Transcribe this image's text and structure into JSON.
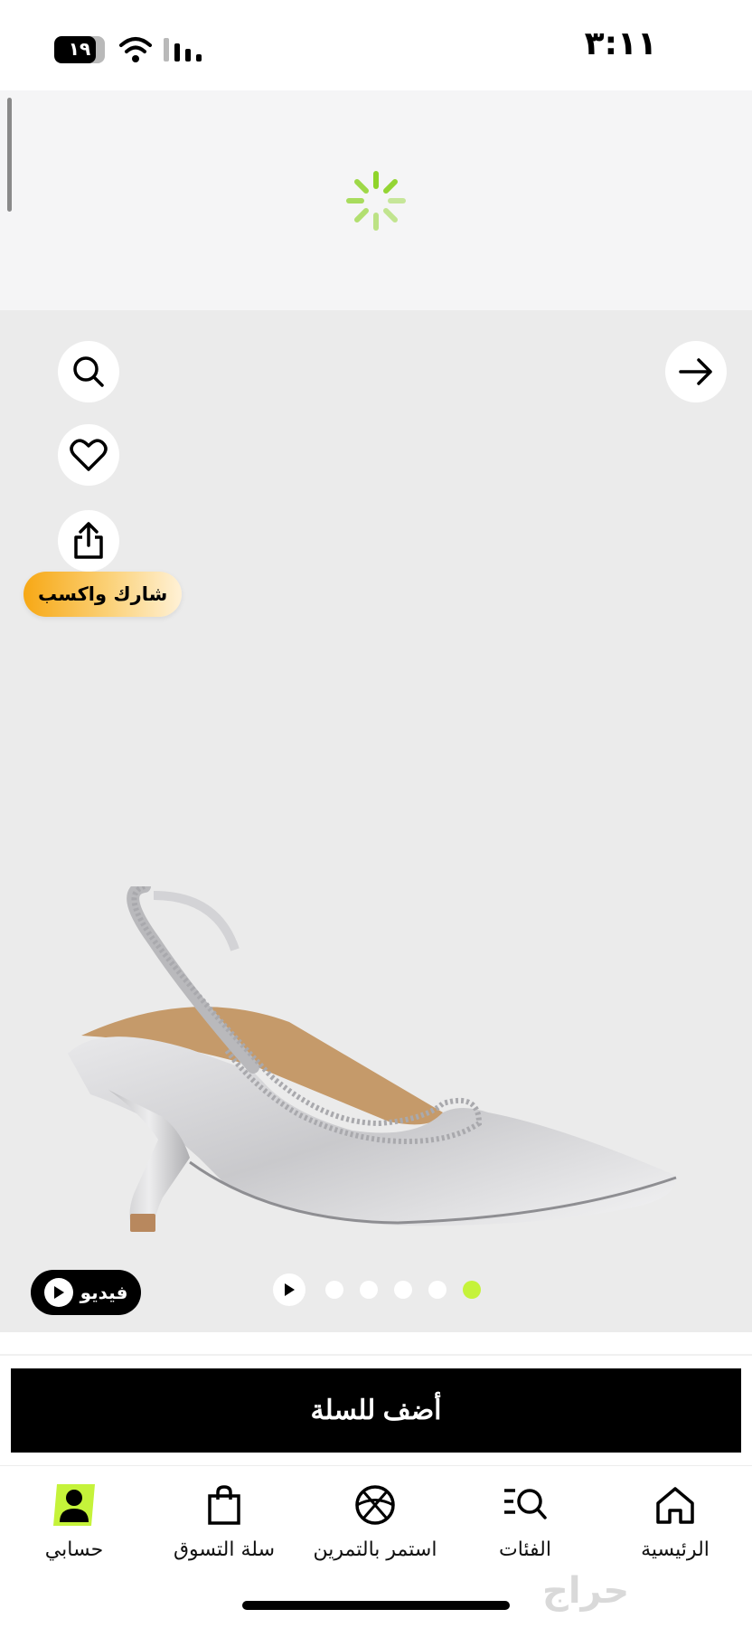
{
  "status_bar": {
    "time": "٣:١١",
    "battery": "١٩"
  },
  "gallery": {
    "share_earn_label": "شارك واكسب",
    "video_label": "فيديو",
    "dots_count": 5,
    "active_dot_index": 4
  },
  "actions": {
    "add_to_cart": "أضف للسلة"
  },
  "bottom_nav": {
    "items": [
      {
        "label": "حسابي",
        "icon": "user-icon"
      },
      {
        "label": "سلة التسوق",
        "icon": "shopping-bag-icon"
      },
      {
        "label": "استمر بالتمرين",
        "icon": "basketball-icon"
      },
      {
        "label": "الفئات",
        "icon": "categories-search-icon"
      },
      {
        "label": "الرئيسية",
        "icon": "home-icon"
      }
    ]
  },
  "watermark": "حراج",
  "colors": {
    "accent": "#c5f33a",
    "spinner": "#8fd42a",
    "share_gradient_start": "#f7a815"
  }
}
